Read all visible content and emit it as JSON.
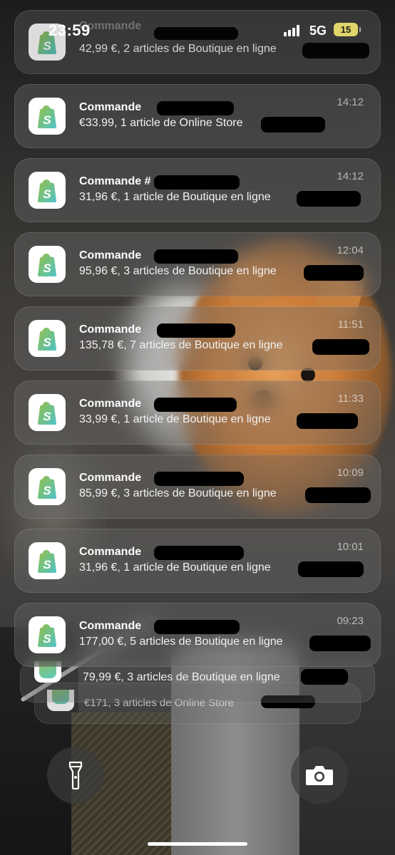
{
  "status_bar": {
    "time": "23:59",
    "network": "5G",
    "battery": "15"
  },
  "notifications": [
    {
      "title": "Commande",
      "body": "42,99 €, 2 articles de Boutique en ligne",
      "time": ""
    },
    {
      "title": "Commande",
      "body": "€33.99, 1 article de Online Store",
      "time": "14:12"
    },
    {
      "title": "Commande #",
      "body": "31,96 €, 1 article de Boutique en ligne",
      "time": "14:12"
    },
    {
      "title": "Commande",
      "body": "95,96 €, 3 articles de Boutique en ligne",
      "time": "12:04"
    },
    {
      "title": "Commande",
      "body": "135,78 €, 7 articles de Boutique en ligne",
      "time": "11:51"
    },
    {
      "title": "Commande",
      "body": "33,99 €, 1 article de Boutique en ligne",
      "time": "11:33"
    },
    {
      "title": "Commande",
      "body": "85,99 €, 3 articles de Boutique en ligne",
      "time": "10:09"
    },
    {
      "title": "Commande",
      "body": "31,96 €, 1 article de Boutique en ligne",
      "time": "10:01"
    },
    {
      "title": "Commande",
      "body": "177,00 €, 5 articles de Boutique en ligne",
      "time": "09:23"
    }
  ],
  "stacked": [
    {
      "body": "79,99 €, 3 articles de Boutique en ligne"
    },
    {
      "body": "€171, 3 articles de Online Store"
    }
  ],
  "controls": {
    "left": "flashlight-icon",
    "right": "camera-icon"
  },
  "colors": {
    "icon_green": "#95BF47",
    "icon_teal": "#5ec9c0",
    "battery": "#e0d56a"
  }
}
